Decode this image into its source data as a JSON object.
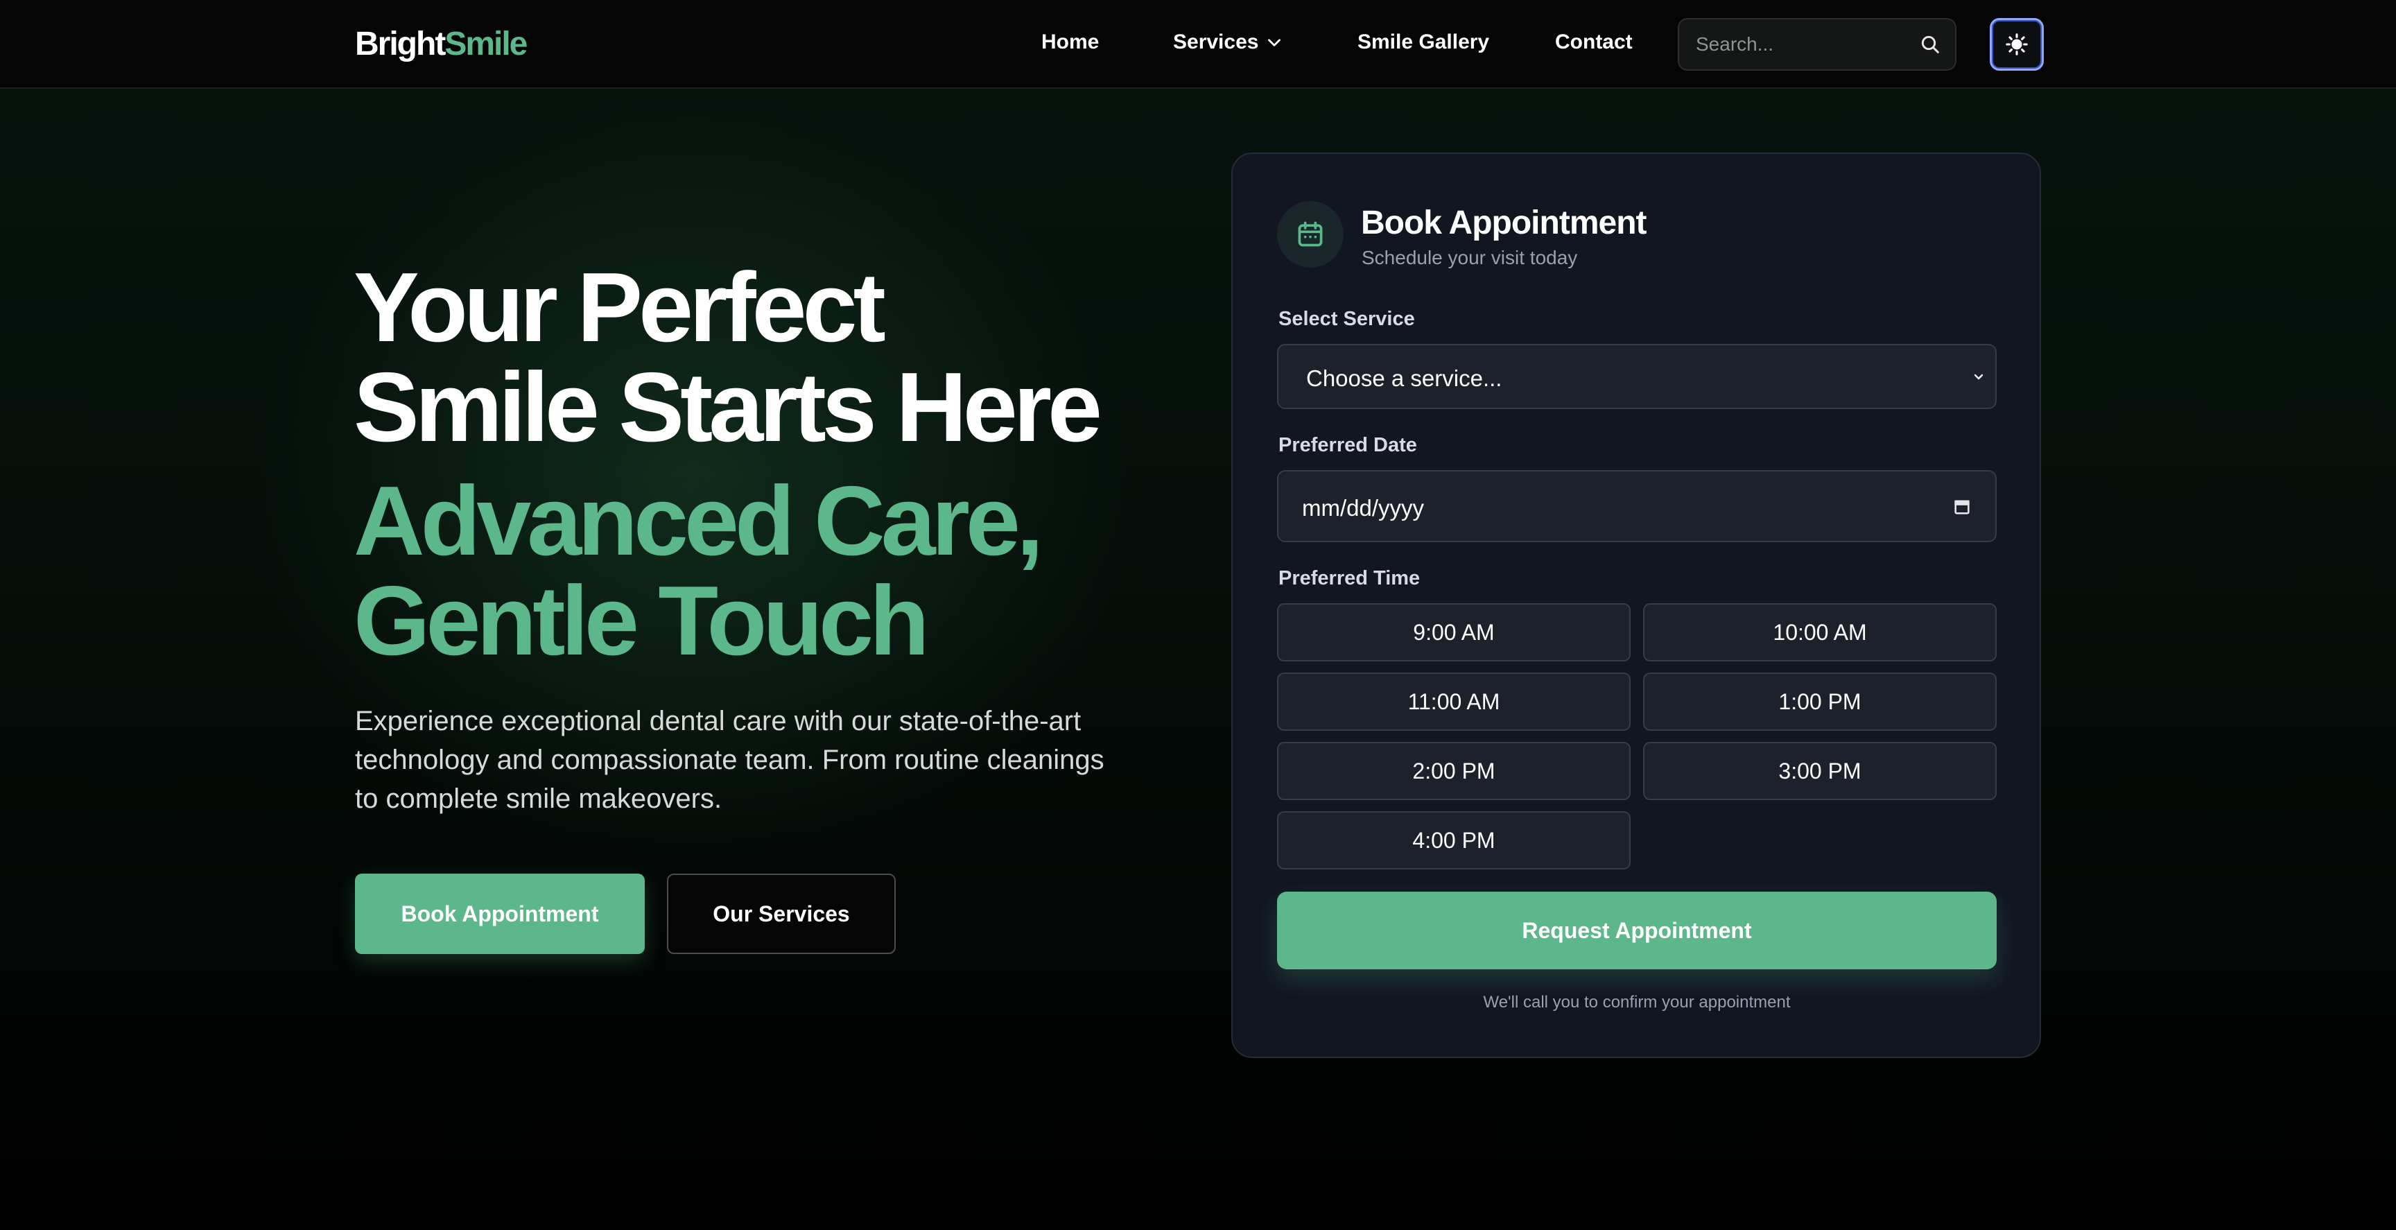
{
  "header": {
    "logo_part1": "Bright",
    "logo_part2": "Smile",
    "nav": {
      "home": "Home",
      "services": "Services",
      "gallery": "Smile Gallery",
      "contact": "Contact"
    },
    "search_placeholder": "Search..."
  },
  "hero": {
    "title_line1": "Your Perfect",
    "title_line2": "Smile Starts Here",
    "subtitle_line1": "Advanced Care,",
    "subtitle_line2": "Gentle Touch",
    "description": "Experience exceptional dental care with our state-of-the-art technology and compassionate team. From routine cleanings to complete smile makeovers.",
    "primary_button": "Book Appointment",
    "secondary_button": "Our Services"
  },
  "booking": {
    "title": "Book Appointment",
    "subtitle": "Schedule your visit today",
    "service_label": "Select Service",
    "service_value": "Choose a service...",
    "date_label": "Preferred Date",
    "date_value": "mm/dd/yyyy",
    "time_label": "Preferred Time",
    "time_slots": [
      "9:00 AM",
      "10:00 AM",
      "11:00 AM",
      "1:00 PM",
      "2:00 PM",
      "3:00 PM",
      "4:00 PM"
    ],
    "submit_button": "Request Appointment",
    "note": "We'll call you to confirm your appointment"
  },
  "icons": {
    "search": "search-icon",
    "theme": "sun-icon",
    "services_dropdown": "chevron-down-icon",
    "booking": "calendar-icon",
    "select": "chevron-down-icon",
    "date": "calendar-icon"
  },
  "colors": {
    "accent": "#5cb88a",
    "background": "#000000",
    "card": "#111621",
    "field": "#1c212c",
    "toggle_ring": "#8fa8ff"
  }
}
